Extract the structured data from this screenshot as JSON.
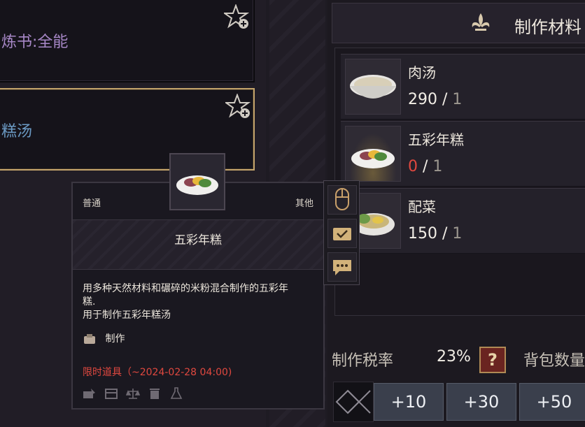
{
  "recipes": [
    {
      "title": "炼书:全能",
      "color": "#a888c8",
      "selected": false
    },
    {
      "title": "糕汤",
      "color": "#6b9ac4",
      "selected": true
    }
  ],
  "materials": {
    "header": "制作材料",
    "items": [
      {
        "name": "肉汤",
        "have": "290",
        "sep": "/",
        "need": "1",
        "icon": "soup-bowl-icon"
      },
      {
        "name": "五彩年糕",
        "have": "0",
        "sep": "/",
        "need": "1",
        "icon": "rice-cake-plate-icon"
      },
      {
        "name": "配菜",
        "have": "150",
        "sep": "/",
        "need": "1",
        "icon": "side-dish-icon"
      }
    ]
  },
  "tax": {
    "label": "制作税率",
    "value": "23%",
    "help": "?",
    "bag_label": "背包数量"
  },
  "steppers": [
    "+10",
    "+30",
    "+50"
  ],
  "tooltip": {
    "grade": "普通",
    "category": "其他",
    "name": "五彩年糕",
    "description_line1": "用多种天然材料和碾碎的米粉混合制作的五彩年",
    "description_line2": "糕.",
    "description_line3": "用于制作五彩年糕汤",
    "craft_label": "制作",
    "limited": "限时道具（~2024-02-28 04:00)"
  },
  "colors": {
    "accent_gold": "#c5a56c",
    "warning_red": "#e0483f",
    "bg": "#1e1b23"
  }
}
